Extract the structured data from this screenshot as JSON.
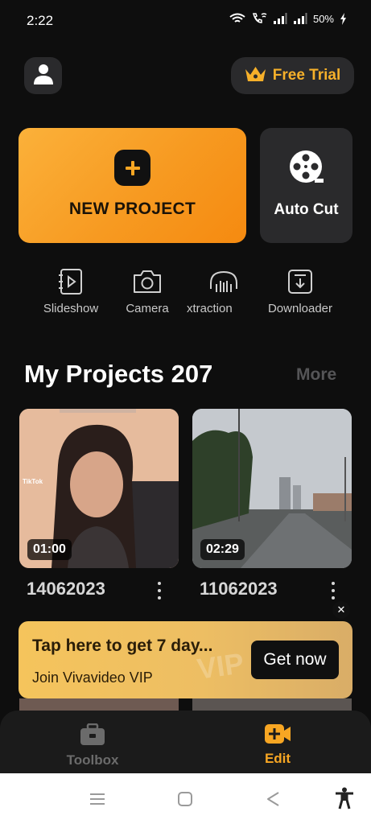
{
  "status_bar": {
    "time": "2:22",
    "battery": "50%"
  },
  "header": {
    "trial_label": "Free Trial"
  },
  "actions": {
    "new_project_label": "NEW PROJECT",
    "auto_cut_label": "Auto Cut"
  },
  "tools": [
    {
      "label": "Slideshow",
      "icon": "slideshow-icon"
    },
    {
      "label": "Camera",
      "icon": "camera-icon"
    },
    {
      "label": "xtraction",
      "icon": "audio-extraction-icon"
    },
    {
      "label": "Downloader",
      "icon": "download-icon"
    }
  ],
  "projects": {
    "title": "My Projects 207",
    "more_label": "More",
    "items": [
      {
        "name": "14062023",
        "duration": "01:00",
        "watermark": "TikTok"
      },
      {
        "name": "11062023",
        "duration": "02:29"
      }
    ]
  },
  "promo": {
    "title": "Tap here to get 7 day...",
    "subtitle": "Join Vivavideo VIP",
    "button_label": "Get now",
    "watermark": "VIP"
  },
  "bottom_nav": {
    "items": [
      {
        "label": "Toolbox",
        "active": false
      },
      {
        "label": "Edit",
        "active": true
      }
    ]
  },
  "colors": {
    "accent": "#f7a623",
    "background": "#0e0e0e",
    "card": "#2a2a2c",
    "inactive": "#6b6b6b"
  }
}
